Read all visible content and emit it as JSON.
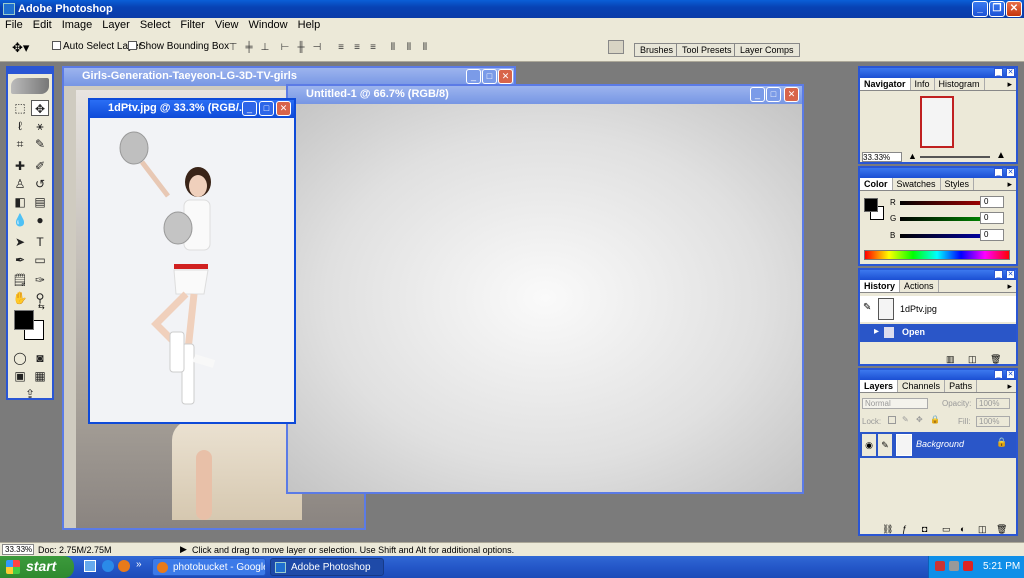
{
  "app": {
    "title": "Adobe Photoshop"
  },
  "menu": [
    "File",
    "Edit",
    "Image",
    "Layer",
    "Select",
    "Filter",
    "View",
    "Window",
    "Help"
  ],
  "options": {
    "auto_select": "Auto Select Layer",
    "show_bbox": "Show Bounding Box",
    "wells": [
      "Brushes",
      "Tool Presets",
      "Layer Comps"
    ]
  },
  "documents": {
    "bg_doc": "Girls-Generation-Taeyeon-LG-3D-TV-girls",
    "untitled": "Untitled-1 @ 66.7% (RGB/8)",
    "active": "1dPtv.jpg @ 33.3% (RGB/..."
  },
  "navigator": {
    "tabs": [
      "Navigator",
      "Info",
      "Histogram"
    ],
    "zoom": "33.33%"
  },
  "color": {
    "tabs": [
      "Color",
      "Swatches",
      "Styles"
    ],
    "channels": [
      {
        "label": "R",
        "value": "0",
        "color": "#c00000"
      },
      {
        "label": "G",
        "value": "0",
        "color": "#00a000"
      },
      {
        "label": "B",
        "value": "0",
        "color": "#0000c0"
      }
    ]
  },
  "history": {
    "tabs": [
      "History",
      "Actions"
    ],
    "snapshot": "1dPtv.jpg",
    "step": "Open"
  },
  "layers": {
    "tabs": [
      "Layers",
      "Channels",
      "Paths"
    ],
    "blend": "Normal",
    "opacity_label": "Opacity:",
    "opacity_value": "100%",
    "lock_label": "Lock:",
    "fill_label": "Fill:",
    "fill_value": "100%",
    "layer_name": "Background"
  },
  "status": {
    "zoom": "33.33%",
    "doc": "Doc: 2.75M/2.75M",
    "hint": "Click and drag to move layer or selection.  Use Shift and Alt for additional options."
  },
  "taskbar": {
    "start": "start",
    "items": [
      "photobucket - Google...",
      "Adobe Photoshop"
    ],
    "clock": "5:21 PM"
  }
}
